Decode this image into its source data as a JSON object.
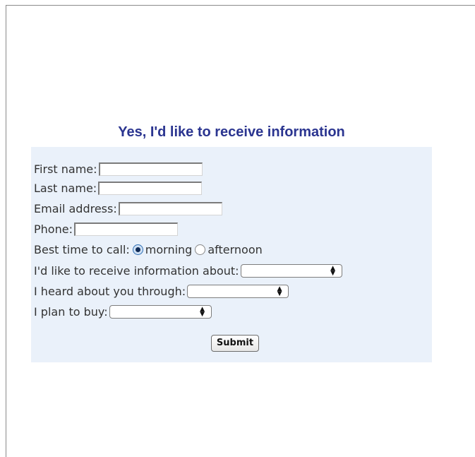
{
  "form": {
    "heading": "Yes, I'd like to receive information",
    "fields": {
      "first_name": {
        "label": "First name:",
        "value": ""
      },
      "last_name": {
        "label": "Last name:",
        "value": ""
      },
      "email": {
        "label": "Email address:",
        "value": ""
      },
      "phone": {
        "label": "Phone:",
        "value": ""
      }
    },
    "best_time": {
      "label": "Best time to call:",
      "options": [
        "morning",
        "afternoon"
      ],
      "selected": "morning"
    },
    "info_about": {
      "label": "I'd like to receive information about:",
      "value": ""
    },
    "heard_through": {
      "label": "I heard about you through:",
      "value": ""
    },
    "plan_to_buy": {
      "label": "I plan to buy:",
      "value": ""
    },
    "submit_label": "Submit"
  },
  "colors": {
    "heading": "#2b3590",
    "panel": "#eaf1fa",
    "radio_selected": "#2f6fb5"
  },
  "icons": {
    "select_arrow": "up-down-arrows-icon"
  }
}
